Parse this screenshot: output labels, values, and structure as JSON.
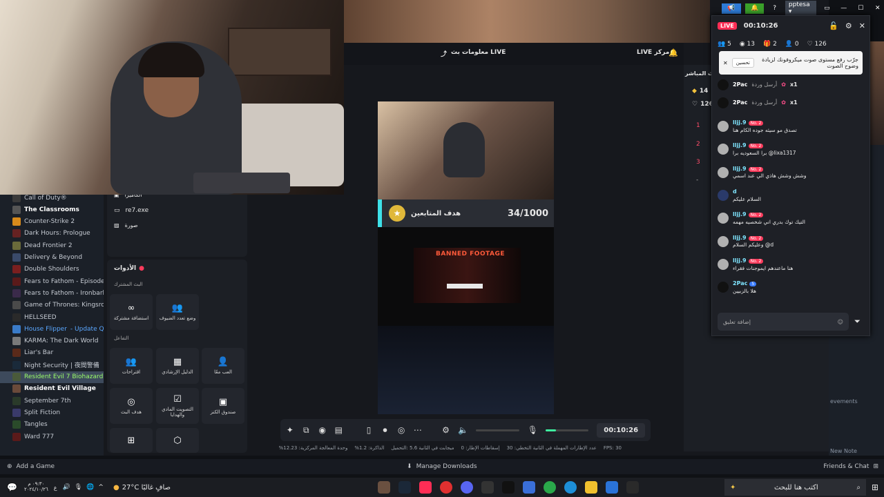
{
  "window_controls": {
    "user": "pptesa"
  },
  "steam": {
    "games": [
      {
        "name": "Call of Duty®",
        "color": "#3a3a3a",
        "style": ""
      },
      {
        "name": "The Classrooms",
        "color": "#555555",
        "style": "bold"
      },
      {
        "name": "Counter-Strike 2",
        "color": "#d88a1b",
        "style": ""
      },
      {
        "name": "Dark Hours: Prologue",
        "color": "#662222",
        "style": ""
      },
      {
        "name": "Dead Frontier 2",
        "color": "#6a6a3a",
        "style": ""
      },
      {
        "name": "Delivery & Beyond",
        "color": "#3a4a6a",
        "style": ""
      },
      {
        "name": "Double Shoulders",
        "color": "#7a1f1f",
        "style": ""
      },
      {
        "name": "Fears to Fathom - Episode 1",
        "color": "#5a1a1a",
        "style": ""
      },
      {
        "name": "Fears to Fathom - Ironbark L",
        "color": "#3a2a4a",
        "style": ""
      },
      {
        "name": "Game of Thrones: Kingsroad",
        "color": "#4a4a4a",
        "style": ""
      },
      {
        "name": "HELLSEED",
        "color": "#2a2a2a",
        "style": ""
      },
      {
        "name": "House Flipper",
        "color": "#3a7bc8",
        "style": "update",
        "extra": "- Update Queu"
      },
      {
        "name": "KARMA: The Dark World",
        "color": "#7a7a7a",
        "style": ""
      },
      {
        "name": "Liar's Bar",
        "color": "#5a2a1a",
        "style": ""
      },
      {
        "name": "Night Security | 夜間警備",
        "color": "#1a2a3a",
        "style": ""
      },
      {
        "name": "Resident Evil 7 Biohazard",
        "color": "#4a5a3a",
        "style": "selected",
        "extra": "- F"
      },
      {
        "name": "Resident Evil Village",
        "color": "#6a4a3a",
        "style": "bold"
      },
      {
        "name": "September 7th",
        "color": "#2a3a2a",
        "style": ""
      },
      {
        "name": "Split Fiction",
        "color": "#3a3a6a",
        "style": ""
      },
      {
        "name": "Tangles",
        "color": "#2a4a2a",
        "style": ""
      },
      {
        "name": "Ward 777",
        "color": "#5a1a1a",
        "style": ""
      }
    ],
    "add_game": "Add a Game",
    "manage_downloads": "Manage Downloads",
    "friends_chat": "Friends & Chat",
    "new_note": "New Note",
    "achievements": "evements"
  },
  "studio": {
    "header": {
      "live_info": "معلومات بث LIVE",
      "live_center": "LIVE مركز"
    },
    "sources": {
      "items": [
        {
          "label": "الكاميرا",
          "icon": "camera-icon"
        },
        {
          "label": "re7.exe",
          "icon": "window-icon"
        },
        {
          "label": "صورة",
          "icon": "image-icon"
        }
      ]
    },
    "tools": {
      "title": "الأدوات",
      "section_shared": "البث المشترك",
      "section_interaction": "التفاعل",
      "tiles": [
        {
          "label": "استضافة مشتركة",
          "glyph": "∞"
        },
        {
          "label": "وضع تعدد الضيوف",
          "glyph": "👥"
        },
        {
          "label": "اقتراحات",
          "glyph": "👥"
        },
        {
          "label": "الدليل الإرشادي",
          "glyph": "▦"
        },
        {
          "label": "العب معًا",
          "glyph": "👤"
        },
        {
          "label": "هدف البث",
          "glyph": "◎"
        },
        {
          "label": "التصويت المادي والهدايا",
          "glyph": "☑"
        },
        {
          "label": "صندوق الكنز",
          "glyph": "▣"
        },
        {
          "label": "",
          "glyph": "⊞"
        },
        {
          "label": "",
          "glyph": "⬡"
        }
      ]
    },
    "preview": {
      "goal_count": "34/1000",
      "goal_label": "هدف المتابعين",
      "banned_title": "BANNED FOOTAGE"
    },
    "toolbar": {
      "timer": "00:10:26"
    },
    "stats": {
      "fps": "FPS: 30",
      "frames_dropped": "30 :عدد الإطارات المهملة في الثانية التخطي",
      "lost": "0 :إسقاطات الإطار",
      "bitrate": "ميجابت في الثانية 5.6 :التحميل",
      "cpu": "%1.2 :الذاكرة",
      "gpu": "%12.23 :وحدة المعالجة المركزية"
    },
    "right_panel": {
      "title": "البث المباشر",
      "diamonds": "14",
      "likes": "126",
      "ranks": [
        "1",
        "2",
        "3",
        "-"
      ]
    }
  },
  "chat": {
    "live": "LIVE",
    "timer": "00:10:26",
    "stats": {
      "viewers": "5",
      "views": "13",
      "gifts": "2",
      "follows": "0",
      "likes": "126"
    },
    "notice": {
      "text": "جرّب رفع مستوى صوت ميكروفونك لزيادة وضوح الصوت",
      "button": "تحسين"
    },
    "gift_rows": [
      {
        "user": "2Pac",
        "text": "أرسل وردة",
        "mult": "x1"
      },
      {
        "user": "2Pac",
        "text": "أرسل وردة",
        "mult": "x1"
      }
    ],
    "messages": [
      {
        "user": "lljj.9",
        "badge": "No. 2",
        "text": "تصدق مو سيئه جوده الكام هنا"
      },
      {
        "user": "lljj.9",
        "badge": "No. 2",
        "text": "برا السعوديه برا @lixa1317"
      },
      {
        "user": "lljj.9",
        "badge": "No. 2",
        "text": "وشش وشش هاذي الي عند اسمي"
      },
      {
        "user": "d",
        "badge": "",
        "text": "السلام عليكم"
      },
      {
        "user": "lljj.9",
        "badge": "No. 2",
        "text": "التيك توك بدري اني شخصيه مهمه"
      },
      {
        "user": "lljj.9",
        "badge": "No. 2",
        "text": "وعليكم السلام @d"
      },
      {
        "user": "lljj.9",
        "badge": "No. 2",
        "text": "هنا ماعندهم ايموجنات فقراء"
      },
      {
        "user": "2Pac",
        "badge": "5",
        "text": "هلا بالزبيين"
      }
    ],
    "input_placeholder": "إضافة تعليق"
  },
  "taskbar": {
    "weather": "27°C  صافٍ غالبًا",
    "search": "اكتب هنا للبحث",
    "time": "٠٩:٣٠ م",
    "date": "٢٠٢٤/١٠/٢٦"
  }
}
